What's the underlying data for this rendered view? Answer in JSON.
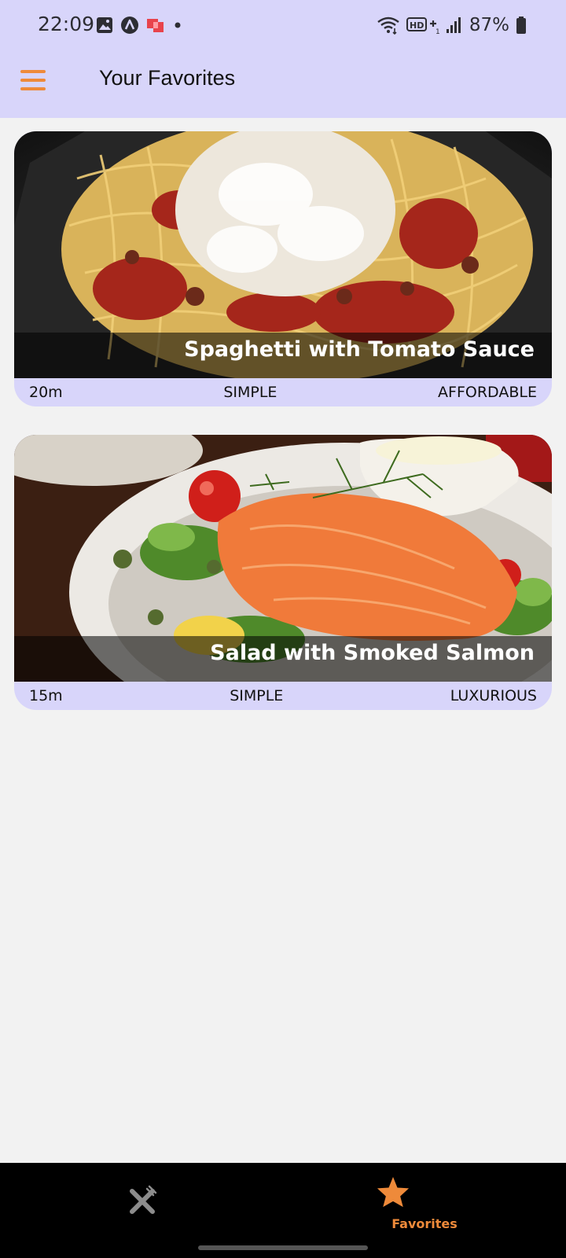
{
  "status_bar": {
    "time": "22:09",
    "battery": "87%",
    "left_icons": [
      "gallery-icon",
      "app-a-icon",
      "notification-icon",
      "dot-icon"
    ],
    "right_icons": [
      "wifi-icon",
      "hd-voice-icon",
      "signal-icon",
      "battery-icon"
    ]
  },
  "app_bar": {
    "title": "Your Favorites",
    "menu_icon": "menu-icon"
  },
  "meals": [
    {
      "title": "Spaghetti with Tomato Sauce",
      "duration": "20m",
      "complexity": "SIMPLE",
      "affordability": "AFFORDABLE"
    },
    {
      "title": "Salad with Smoked Salmon",
      "duration": "15m",
      "complexity": "SIMPLE",
      "affordability": "LUXURIOUS"
    }
  ],
  "bottom_nav": {
    "items": [
      {
        "icon": "cutlery-icon",
        "label": "",
        "active": false
      },
      {
        "icon": "star-icon",
        "label": "Favorites",
        "active": true
      }
    ]
  },
  "colors": {
    "app_bar": "#d8d5fa",
    "accent": "#ee8a3a",
    "background": "#f2f2f2",
    "nav_background": "#000000"
  }
}
